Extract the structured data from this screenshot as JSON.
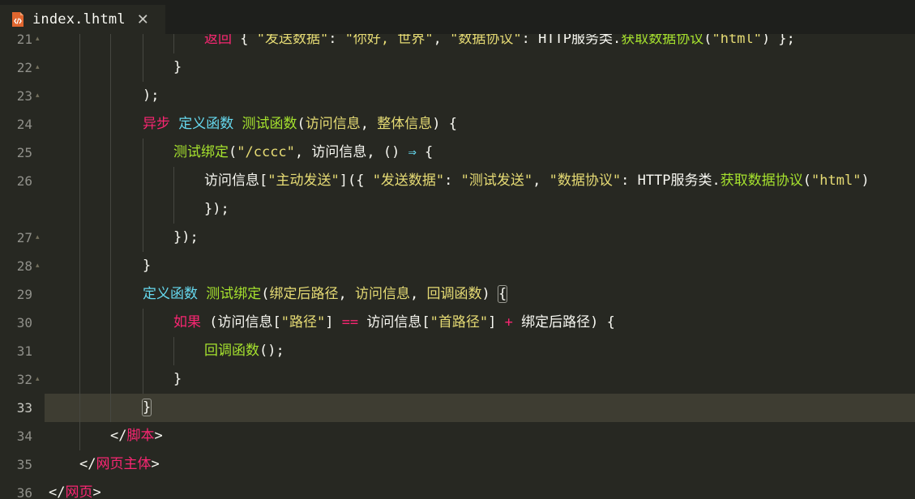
{
  "tab": {
    "filename": "index.lhtml",
    "close_glyph": "✕",
    "icon": "html-file-icon"
  },
  "colors": {
    "background": "#272822",
    "keyword": "#f92672",
    "function": "#a6e22e",
    "storage": "#66d9ef",
    "string": "#e6db74"
  },
  "lines": [
    {
      "num": "21",
      "tokens": [
        {
          "t": "返回",
          "c": "kw"
        },
        {
          "t": " { ",
          "c": "pn"
        },
        {
          "t": "\"发送数据\"",
          "c": "str"
        },
        {
          "t": ": ",
          "c": "pn"
        },
        {
          "t": "\"你好, 世界\"",
          "c": "str"
        },
        {
          "t": ", ",
          "c": "pn"
        },
        {
          "t": "\"数据协议\"",
          "c": "str"
        },
        {
          "t": ": HTTP服务类.",
          "c": "pn"
        },
        {
          "t": "获取数据协议",
          "c": "fn"
        },
        {
          "t": "(",
          "c": "pn"
        },
        {
          "t": "\"html\"",
          "c": "str"
        },
        {
          "t": ") };",
          "c": "pn"
        }
      ]
    },
    {
      "num": "22",
      "tokens": [
        {
          "t": "}",
          "c": "pn"
        }
      ]
    },
    {
      "num": "23",
      "tokens": [
        {
          "t": ");",
          "c": "pn"
        }
      ]
    },
    {
      "num": "24",
      "tokens": [
        {
          "t": "异步",
          "c": "kw"
        },
        {
          "t": " ",
          "c": "pn"
        },
        {
          "t": "定义函数",
          "c": "st"
        },
        {
          "t": " ",
          "c": "pn"
        },
        {
          "t": "测试函数",
          "c": "fn"
        },
        {
          "t": "(",
          "c": "pn"
        },
        {
          "t": "访问信息",
          "c": "str"
        },
        {
          "t": ", ",
          "c": "pn"
        },
        {
          "t": "整体信息",
          "c": "str"
        },
        {
          "t": ") {",
          "c": "pn"
        }
      ]
    },
    {
      "num": "25",
      "tokens": [
        {
          "t": "测试绑定",
          "c": "fn"
        },
        {
          "t": "(",
          "c": "pn"
        },
        {
          "t": "\"/cccc\"",
          "c": "str"
        },
        {
          "t": ", 访问信息, () ",
          "c": "pn"
        },
        {
          "t": "⇒",
          "c": "arrow"
        },
        {
          "t": " {",
          "c": "pn"
        }
      ]
    },
    {
      "num": "26",
      "tokens": [
        {
          "t": "访问信息[",
          "c": "pn"
        },
        {
          "t": "\"主动发送\"",
          "c": "str"
        },
        {
          "t": "]({ ",
          "c": "pn"
        },
        {
          "t": "\"发送数据\"",
          "c": "str"
        },
        {
          "t": ": ",
          "c": "pn"
        },
        {
          "t": "\"测试发送\"",
          "c": "str"
        },
        {
          "t": ", ",
          "c": "pn"
        },
        {
          "t": "\"数据协议\"",
          "c": "str"
        },
        {
          "t": ": HTTP服务类.",
          "c": "pn"
        },
        {
          "t": "获取数据协议",
          "c": "fn"
        },
        {
          "t": "(",
          "c": "pn"
        },
        {
          "t": "\"html\"",
          "c": "str"
        },
        {
          "t": ")",
          "c": "pn"
        }
      ]
    },
    {
      "num": "",
      "tokens": [
        {
          "t": "});",
          "c": "pn"
        }
      ]
    },
    {
      "num": "27",
      "tokens": [
        {
          "t": "});",
          "c": "pn"
        }
      ]
    },
    {
      "num": "28",
      "tokens": [
        {
          "t": "}",
          "c": "pn"
        }
      ]
    },
    {
      "num": "29",
      "tokens": [
        {
          "t": "定义函数",
          "c": "st"
        },
        {
          "t": " ",
          "c": "pn"
        },
        {
          "t": "测试绑定",
          "c": "fn"
        },
        {
          "t": "(",
          "c": "pn"
        },
        {
          "t": "绑定后路径",
          "c": "str"
        },
        {
          "t": ", ",
          "c": "pn"
        },
        {
          "t": "访问信息",
          "c": "str"
        },
        {
          "t": ", ",
          "c": "pn"
        },
        {
          "t": "回调函数",
          "c": "str"
        },
        {
          "t": ") ",
          "c": "pn"
        },
        {
          "t": "{",
          "c": "pn",
          "m": 1
        }
      ]
    },
    {
      "num": "30",
      "tokens": [
        {
          "t": "如果",
          "c": "kw"
        },
        {
          "t": " (访问信息[",
          "c": "pn"
        },
        {
          "t": "\"路径\"",
          "c": "str"
        },
        {
          "t": "] ",
          "c": "pn"
        },
        {
          "t": "==",
          "c": "kw"
        },
        {
          "t": " 访问信息[",
          "c": "pn"
        },
        {
          "t": "\"首路径\"",
          "c": "str"
        },
        {
          "t": "] ",
          "c": "pn"
        },
        {
          "t": "+",
          "c": "kw"
        },
        {
          "t": " 绑定后路径) {",
          "c": "pn"
        }
      ]
    },
    {
      "num": "31",
      "tokens": [
        {
          "t": "回调函数",
          "c": "fn"
        },
        {
          "t": "();",
          "c": "pn"
        }
      ]
    },
    {
      "num": "32",
      "tokens": [
        {
          "t": "}",
          "c": "pn"
        }
      ]
    },
    {
      "num": "33",
      "tokens": [
        {
          "t": "}",
          "c": "pn",
          "m": 1
        }
      ]
    },
    {
      "num": "34",
      "tokens": [
        {
          "t": "</",
          "c": "pn"
        },
        {
          "t": "脚本",
          "c": "tag"
        },
        {
          "t": ">",
          "c": "pn"
        }
      ]
    },
    {
      "num": "35",
      "tokens": [
        {
          "t": "</",
          "c": "pn"
        },
        {
          "t": "网页主体",
          "c": "tag"
        },
        {
          "t": ">",
          "c": "pn"
        }
      ]
    },
    {
      "num": "36",
      "tokens": [
        {
          "t": "</",
          "c": "pn"
        },
        {
          "t": "网页",
          "c": "tag"
        },
        {
          "t": ">",
          "c": "pn"
        }
      ]
    }
  ]
}
